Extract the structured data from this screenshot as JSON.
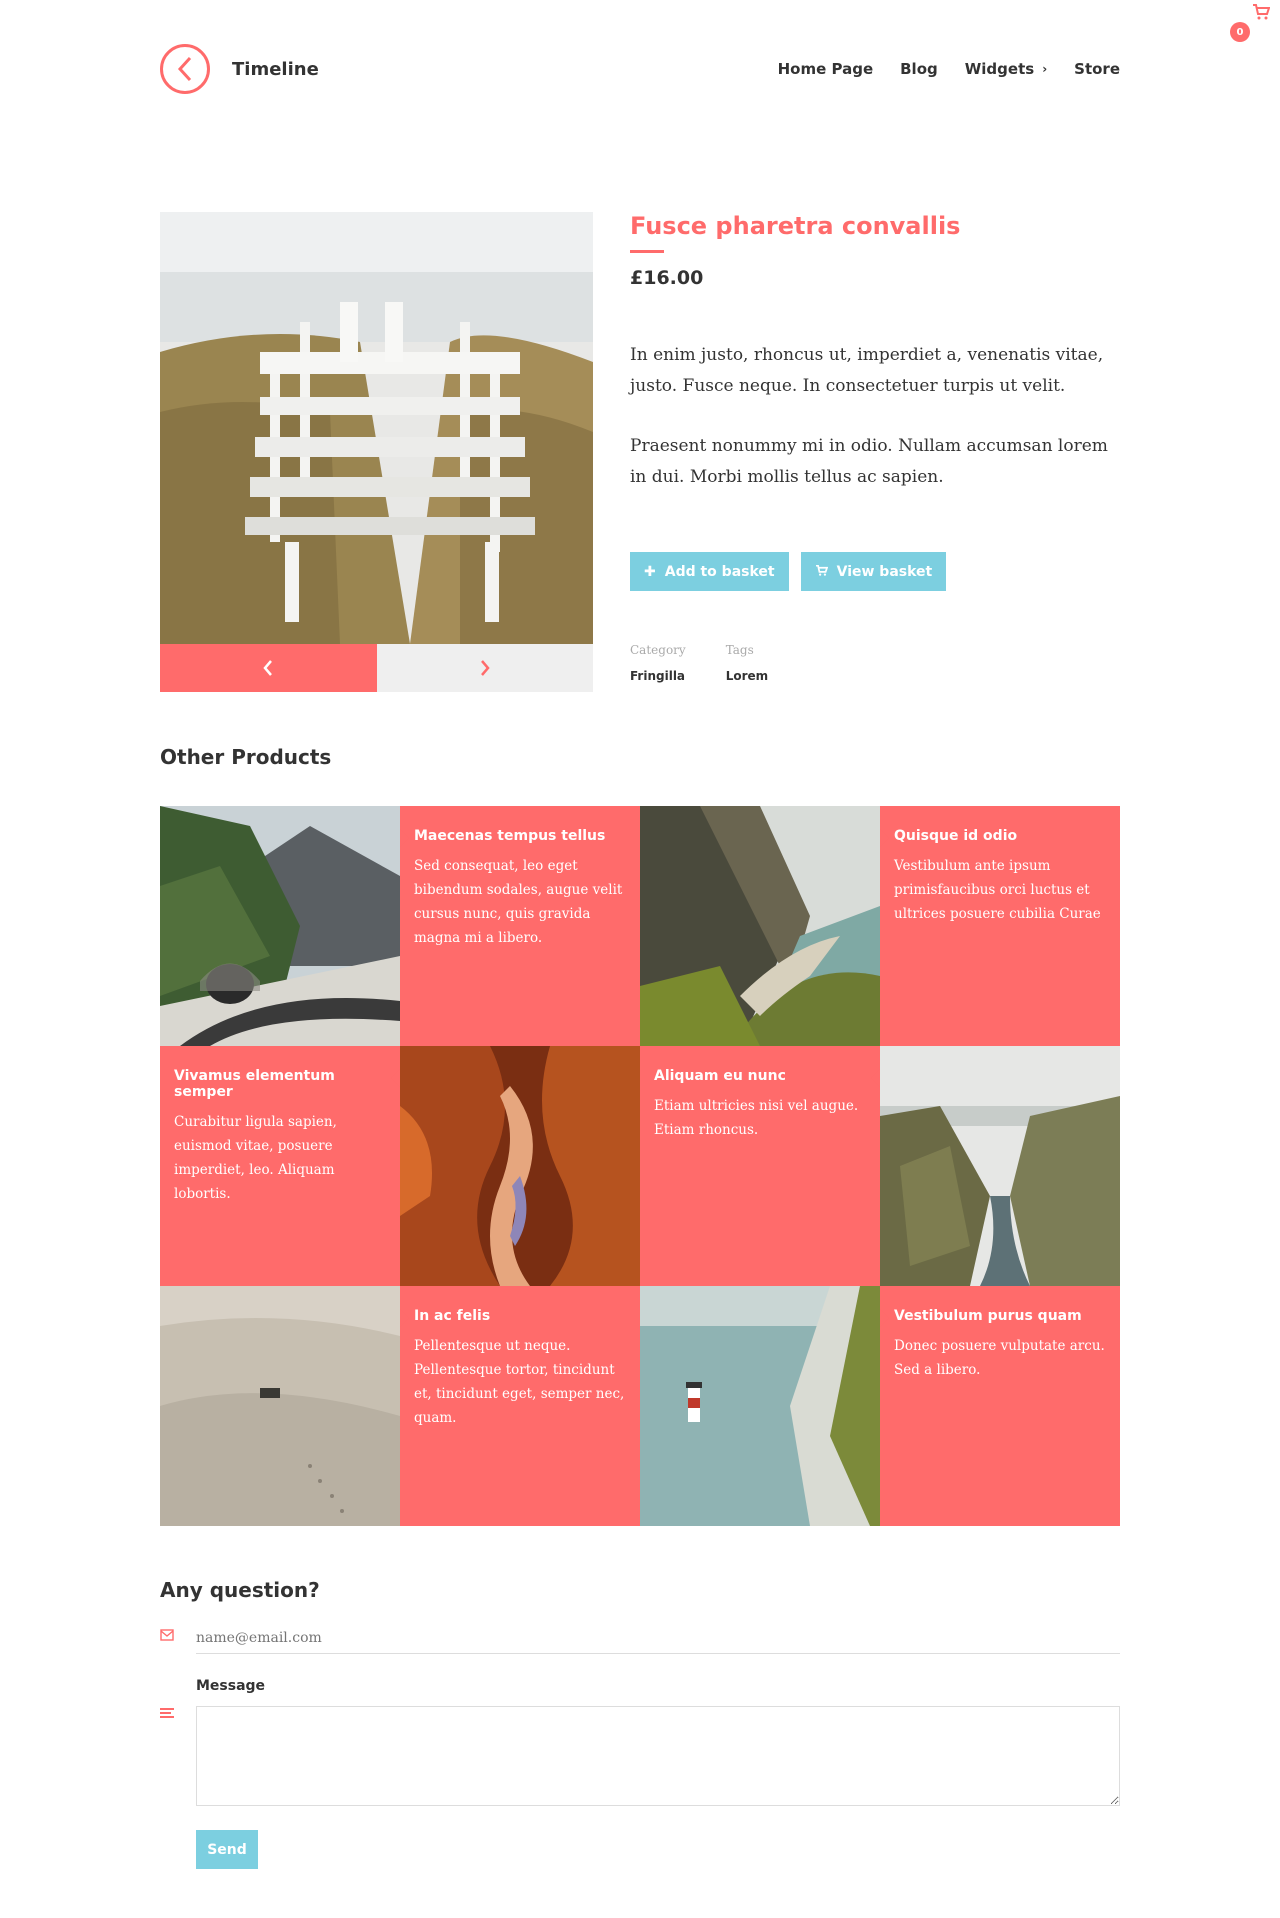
{
  "header": {
    "site_title": "Timeline",
    "nav": [
      "Home Page",
      "Blog",
      "Widgets",
      "Store"
    ],
    "cart_count": "0"
  },
  "product": {
    "title": "Fusce pharetra convallis",
    "price": "£16.00",
    "description": [
      "In enim justo, rhoncus ut, imperdiet a, venenatis vitae, justo. Fusce neque. In consectetuer turpis ut velit.",
      "Praesent nonummy mi in odio. Nullam accumsan lorem in dui. Morbi mollis tellus ac sapien."
    ],
    "add_to_basket": "Add to basket",
    "view_basket": "View basket",
    "category_label": "Category",
    "category_value": "Fringilla",
    "tags_label": "Tags",
    "tags_value": "Lorem"
  },
  "other_products": {
    "title": "Other Products",
    "items": [
      {
        "title": "Maecenas tempus tellus",
        "text": "Sed consequat, leo eget bibendum sodales, augue velit cursus nunc, quis gravida magna mi a libero."
      },
      {
        "title": "Quisque id odio",
        "text": "Vestibulum ante ipsum primisfaucibus orci luctus et ultrices posuere cubilia Curae"
      },
      {
        "title": "Vivamus elementum semper",
        "text": "Curabitur ligula sapien, euismod vitae, posuere imperdiet, leo. Aliquam lobortis."
      },
      {
        "title": "Aliquam eu nunc",
        "text": "Etiam ultricies nisi vel augue. Etiam rhoncus."
      },
      {
        "title": "In ac felis",
        "text": "Pellentesque ut neque. Pellentesque tortor, tincidunt et, tincidunt eget, semper nec, quam."
      },
      {
        "title": "Vestibulum purus quam",
        "text": "Donec posuere vulputate arcu. Sed a libero."
      }
    ]
  },
  "contact": {
    "title": "Any question?",
    "email_placeholder": "name@email.com",
    "message_label": "Message",
    "send": "Send"
  },
  "colors": {
    "accent": "#ff6b6b",
    "button": "#7ccfe0"
  }
}
